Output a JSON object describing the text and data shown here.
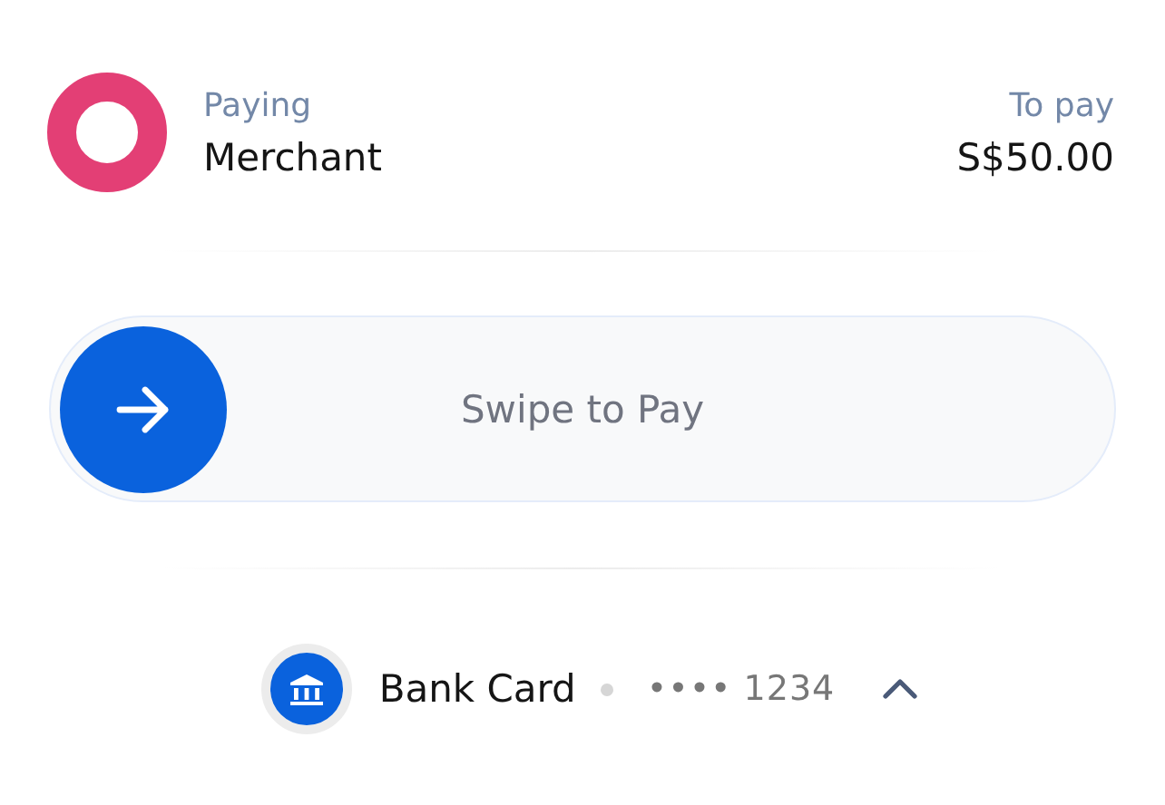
{
  "payee": {
    "label": "Paying",
    "name": "Merchant"
  },
  "amount": {
    "label": "To pay",
    "value": "S$50.00"
  },
  "swipe": {
    "label": "Swipe to Pay",
    "level": 0
  },
  "payment_method": {
    "name": "Bank Card",
    "number": "•••• 1234",
    "expanded": true
  }
}
